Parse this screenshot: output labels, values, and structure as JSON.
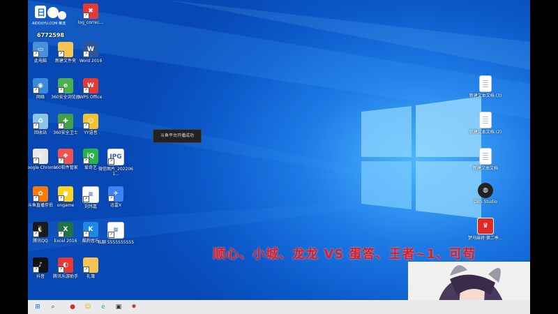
{
  "colors": {
    "wallpaper": "#1d7be6",
    "taskbar": "#e9eaec",
    "banner": "#d0222e",
    "toast_bg": "#222222"
  },
  "top_logo": {
    "text": "AIDOUYU.COM",
    "subtitle": "推流",
    "counter": "6772598"
  },
  "desktop_left": [
    {
      "name": "douyu-icon",
      "label": "",
      "color": "#ffffff",
      "glyph": ""
    },
    {
      "name": "log-correct-icon",
      "label": "log_correc...",
      "color": "#e53935",
      "glyph": "✖"
    },
    {
      "name": "this-pc-icon",
      "label": "此电脑",
      "color": "#4a90d9",
      "glyph": "▭"
    },
    {
      "name": "new-folder-icon",
      "label": "新建文件夹",
      "color": "#f5c451",
      "glyph": ""
    },
    {
      "name": "word-icon",
      "label": "Word 2016",
      "color": "#2b579a",
      "glyph": "W"
    },
    {
      "name": "network-icon",
      "label": "网络",
      "color": "#3a8ad8",
      "glyph": "◉"
    },
    {
      "name": "360-browser-icon",
      "label": "360安全浏览器",
      "color": "#4caf50",
      "glyph": "e"
    },
    {
      "name": "wps-icon",
      "label": "WPS Office",
      "color": "#e53935",
      "glyph": "W"
    },
    {
      "name": "recycle-bin-icon",
      "label": "回收站",
      "color": "#8ec4e8",
      "glyph": "♻"
    },
    {
      "name": "360-guard-icon",
      "label": "360安全卫士",
      "color": "#43a047",
      "glyph": "✚"
    },
    {
      "name": "yy-voice-icon",
      "label": "YY语音",
      "color": "#f2c12e",
      "glyph": "☺"
    },
    {
      "name": "chrome-icon",
      "label": "Google Chrome",
      "color": "#e8e8e8",
      "glyph": "◎"
    },
    {
      "name": "360-software-icon",
      "label": "360软件管家",
      "color": "#ef5350",
      "glyph": "❖"
    },
    {
      "name": "iqiyi-icon",
      "label": "爱奇艺",
      "color": "#28b447",
      "glyph": "iQ"
    },
    {
      "name": "jpg-file-icon",
      "label": "微信图片_2022061...",
      "color": "#ffffff",
      "glyph": "JPG"
    },
    {
      "name": "douyu-live-icon",
      "label": "斗鱼直播伴侣",
      "color": "#ff7a00",
      "glyph": "✿"
    },
    {
      "name": "ongame-icon",
      "label": "ongame",
      "color": "#f9d423",
      "glyph": "●"
    },
    {
      "name": "shortcut-file-icon",
      "label": "刘玮嘉",
      "color": "#ffffff",
      "glyph": "≡"
    },
    {
      "name": "feishu-icon",
      "label": "迅雷X",
      "color": "#3e82f7",
      "glyph": "✈"
    },
    {
      "name": "tencent-qq-icon",
      "label": "腾讯QQ",
      "color": "#1a1a1a",
      "glyph": "🐧"
    },
    {
      "name": "excel-icon",
      "label": "Excel 2016",
      "color": "#217346",
      "glyph": "X"
    },
    {
      "name": "kugou-icon",
      "label": "酷狗音乐",
      "color": "#1e88e5",
      "glyph": "K"
    },
    {
      "name": "text-file-icon",
      "label": "私聊 5555555555",
      "color": "#ffffff",
      "glyph": "≡"
    },
    {
      "name": "douyin-icon",
      "label": "抖音",
      "color": "#111111",
      "glyph": "♪"
    },
    {
      "name": "tencent-video-icon",
      "label": "腾讯乐游助手",
      "color": "#e53935",
      "glyph": "◐"
    },
    {
      "name": "folder-icon",
      "label": "礼簿",
      "color": "#f5c451",
      "glyph": ""
    }
  ],
  "desktop_right": [
    {
      "name": "text-doc-3-icon",
      "label": "新建文本文档 (3)"
    },
    {
      "name": "text-doc-2-icon",
      "label": "新建文本文档 (2)"
    },
    {
      "name": "text-doc-icon",
      "label": "新建文本文档"
    },
    {
      "name": "obs-icon",
      "label": "OBS Studio"
    },
    {
      "name": "mahjong-icon",
      "label": "梦马麻将·第二季…"
    }
  ],
  "toast": {
    "text": "斗鱼平台开播成功"
  },
  "banner": {
    "text": "顺心、小城、龙龙   VS   蛋答、王者~1、可苟"
  },
  "taskbar": {
    "items": [
      {
        "name": "start-button-icon",
        "glyph": "⊞"
      },
      {
        "name": "search-icon",
        "glyph": "⌕"
      },
      {
        "name": "taskbar-douyu-icon",
        "glyph": "●"
      },
      {
        "name": "taskbar-yy-icon",
        "glyph": "☺"
      },
      {
        "name": "taskbar-360-icon",
        "glyph": "e"
      },
      {
        "name": "taskbar-app-icon",
        "glyph": "▣"
      },
      {
        "name": "taskbar-bug-icon",
        "glyph": "✸"
      }
    ]
  }
}
